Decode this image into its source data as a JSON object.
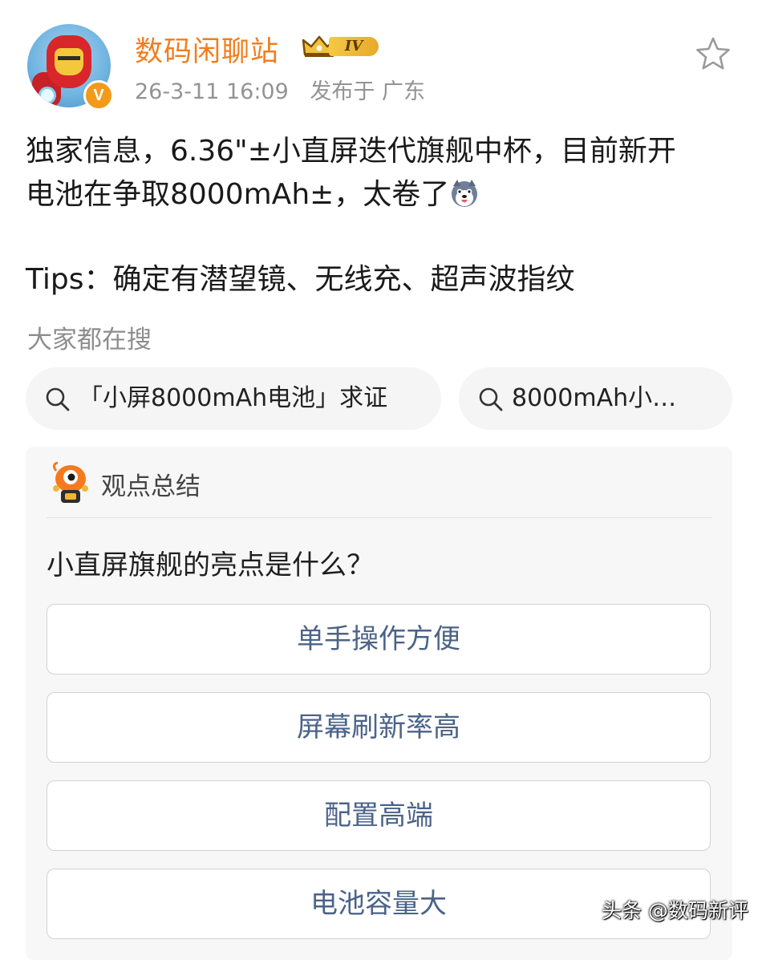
{
  "header": {
    "username": "数码闲聊站",
    "level_badge": "IV",
    "verified_badge": "V",
    "timestamp": "26-3-11 16:09",
    "location": "发布于 广东"
  },
  "post": {
    "line1": "独家信息，6.36\"±小直屏迭代旗舰中杯，目前新开",
    "line2": "电池在争取8000mAh±，太卷了",
    "tips": "Tips：确定有潜望镜、无线充、超声波指纹"
  },
  "search": {
    "label": "大家都在搜",
    "chips": [
      {
        "text": "「小屏8000mAh电池」求证"
      },
      {
        "text": "8000mAh小…"
      }
    ]
  },
  "summary": {
    "title": "观点总结",
    "question": "小直屏旗舰的亮点是什么？",
    "options": [
      {
        "label": "单手操作方便"
      },
      {
        "label": "屏幕刷新率高"
      },
      {
        "label": "配置高端"
      },
      {
        "label": "电池容量大"
      }
    ]
  },
  "watermark": "头条 @数码新评",
  "colors": {
    "username": "#f27d1d",
    "option_text": "#4b6389",
    "meta_text": "#939393"
  }
}
